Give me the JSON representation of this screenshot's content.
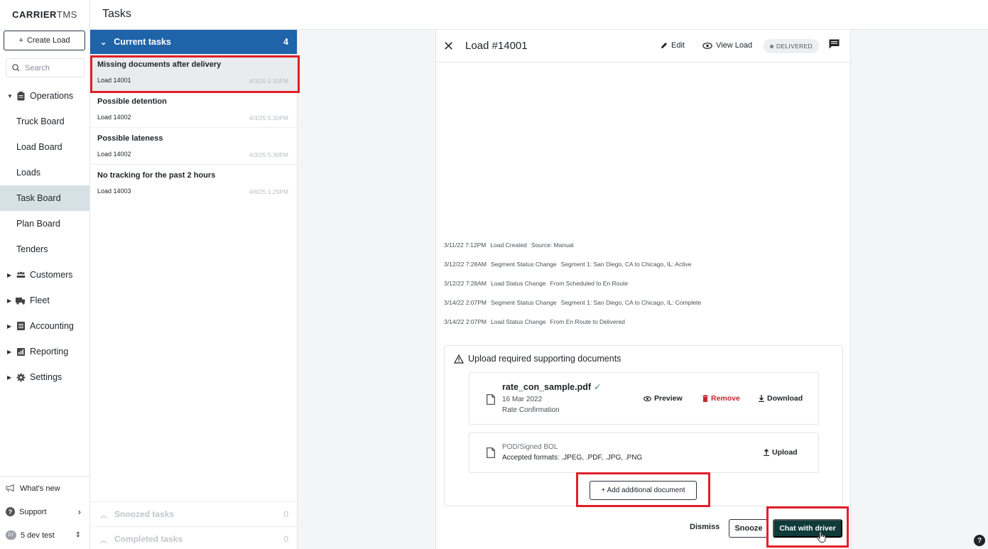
{
  "brand": {
    "bold": "CARRIER",
    "thin": "TMS"
  },
  "sidebar": {
    "create_label": "Create Load",
    "search_placeholder": "Search",
    "items": [
      {
        "label": "Operations",
        "icon": "clipboard-icon",
        "group": true
      },
      {
        "label": "Truck Board"
      },
      {
        "label": "Load Board"
      },
      {
        "label": "Loads"
      },
      {
        "label": "Task Board",
        "active": true
      },
      {
        "label": "Plan Board"
      },
      {
        "label": "Tenders"
      },
      {
        "label": "Customers",
        "icon": "people-icon",
        "group": true
      },
      {
        "label": "Fleet",
        "icon": "truck-icon",
        "group": true
      },
      {
        "label": "Accounting",
        "icon": "ledger-icon",
        "group": true
      },
      {
        "label": "Reporting",
        "icon": "chart-icon",
        "group": true
      },
      {
        "label": "Settings",
        "icon": "gear-icon",
        "group": true
      }
    ],
    "bottom": {
      "whats_new": "What's new",
      "support": "Support",
      "user": "5 dev test",
      "user_initials": "DT"
    }
  },
  "topbar": {
    "title": "Tasks"
  },
  "tasks": {
    "current_label": "Current tasks",
    "current_count": "4",
    "items": [
      {
        "title": "Missing documents after delivery",
        "load": "Load 14001",
        "time": "4/3/25 5:30PM"
      },
      {
        "title": "Possible detention",
        "load": "Load 14002",
        "time": "4/3/25 5:30PM"
      },
      {
        "title": "Possible lateness",
        "load": "Load 14002",
        "time": "4/3/25 5:30PM"
      },
      {
        "title": "No tracking for the past 2 hours",
        "load": "Load 14003",
        "time": "4/8/25 1:25PM"
      }
    ],
    "snoozed_label": "Snoozed tasks",
    "snoozed_count": "0",
    "completed_label": "Completed tasks",
    "completed_count": "0"
  },
  "detail": {
    "title": "Load #14001",
    "edit_label": "Edit",
    "view_label": "View Load",
    "status": "DELIVERED",
    "log": [
      {
        "time": "3/11/22 7:12PM",
        "event": "Load Created",
        "detail": "Source: Manual"
      },
      {
        "time": "3/12/22 7:28AM",
        "event": "Segment Status Change",
        "detail": "Segment 1: San Diego, CA to Chicago, IL: Active"
      },
      {
        "time": "3/12/22 7:28AM",
        "event": "Load Status Change",
        "detail": "From Scheduled to En Route"
      },
      {
        "time": "3/14/22 2:07PM",
        "event": "Segment Status Change",
        "detail": "Segment 1: San Diego, CA to Chicago, IL: Complete"
      },
      {
        "time": "3/14/22 2:07PM",
        "event": "Load Status Change",
        "detail": "From En Route to Delivered"
      }
    ],
    "docs": {
      "title": "Upload required supporting documents",
      "uploaded": {
        "name": "rate_con_sample.pdf",
        "date": "16 Mar 2022",
        "type": "Rate Confirmation",
        "preview": "Preview",
        "remove": "Remove",
        "download": "Download"
      },
      "pending": {
        "name": "POD/Signed BOL",
        "formats": "Accepted formats: .JPEG, .PDF, .JPG, .PNG",
        "upload": "Upload"
      },
      "add_label": "+ Add additional document"
    },
    "dismiss": "Dismiss",
    "snooze": "Snooze",
    "chat": "Chat with driver"
  },
  "colors": {
    "accent": "#1f63a8",
    "primary_button": "#0f3b3a",
    "highlight": "#e0202a",
    "active_nav": "#d6e1e5"
  }
}
